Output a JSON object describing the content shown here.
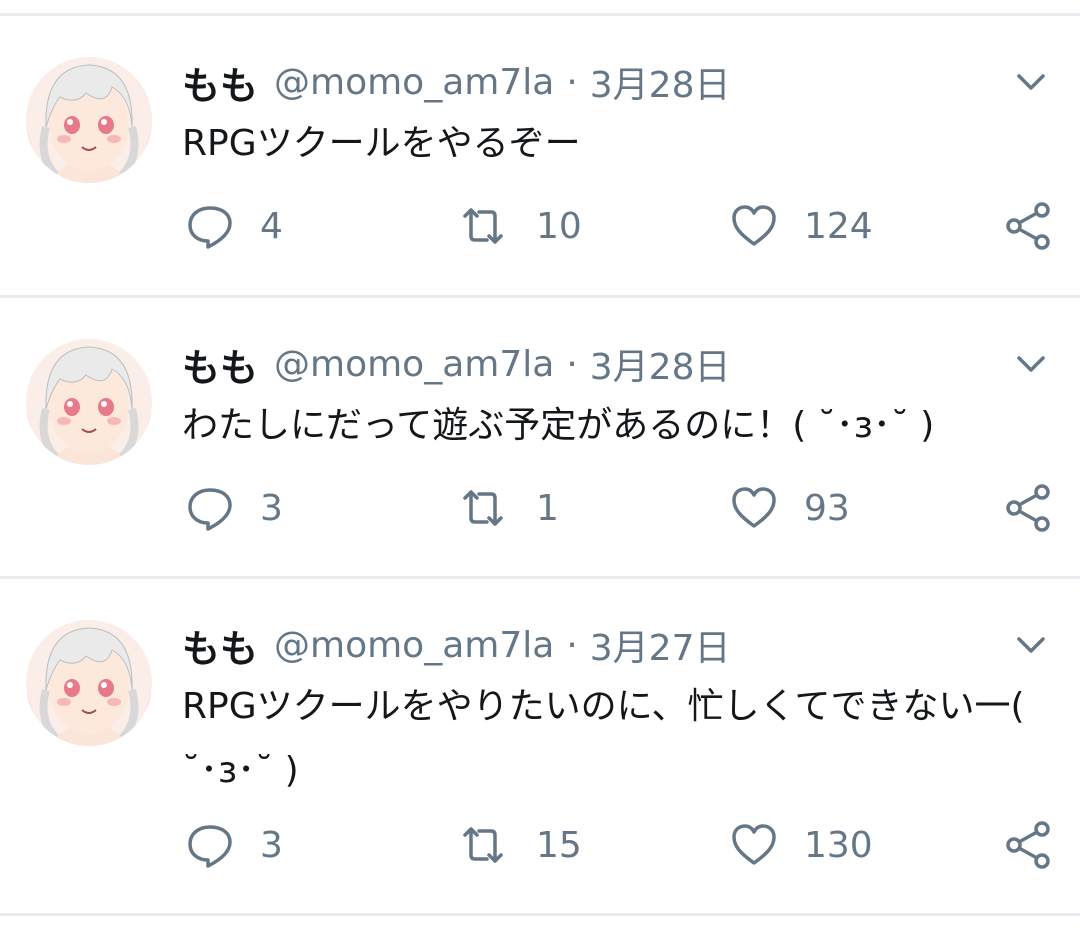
{
  "colors": {
    "text": "#14171a",
    "secondary": "#657786",
    "divider": "#e6ecf0"
  },
  "tweets": [
    {
      "name": "もも",
      "handle": "@momo_am7la",
      "separator": "·",
      "date": "3月28日",
      "text": "RPGツクールをやるぞー",
      "replies": "4",
      "retweets": "10",
      "likes": "124"
    },
    {
      "name": "もも",
      "handle": "@momo_am7la",
      "separator": "·",
      "date": "3月28日",
      "text": "わたしにだって遊ぶ予定があるのに！( ˘･з･˘ )",
      "replies": "3",
      "retweets": "1",
      "likes": "93"
    },
    {
      "name": "もも",
      "handle": "@momo_am7la",
      "separator": "·",
      "date": "3月27日",
      "text": "RPGツクールをやりたいのに、忙しくてできない一( ˘･з･˘ )",
      "replies": "3",
      "retweets": "15",
      "likes": "130"
    }
  ],
  "icons": {
    "reply": "reply-icon",
    "retweet": "retweet-icon",
    "like": "heart-icon",
    "share": "share-icon",
    "more": "chevron-down-icon"
  }
}
